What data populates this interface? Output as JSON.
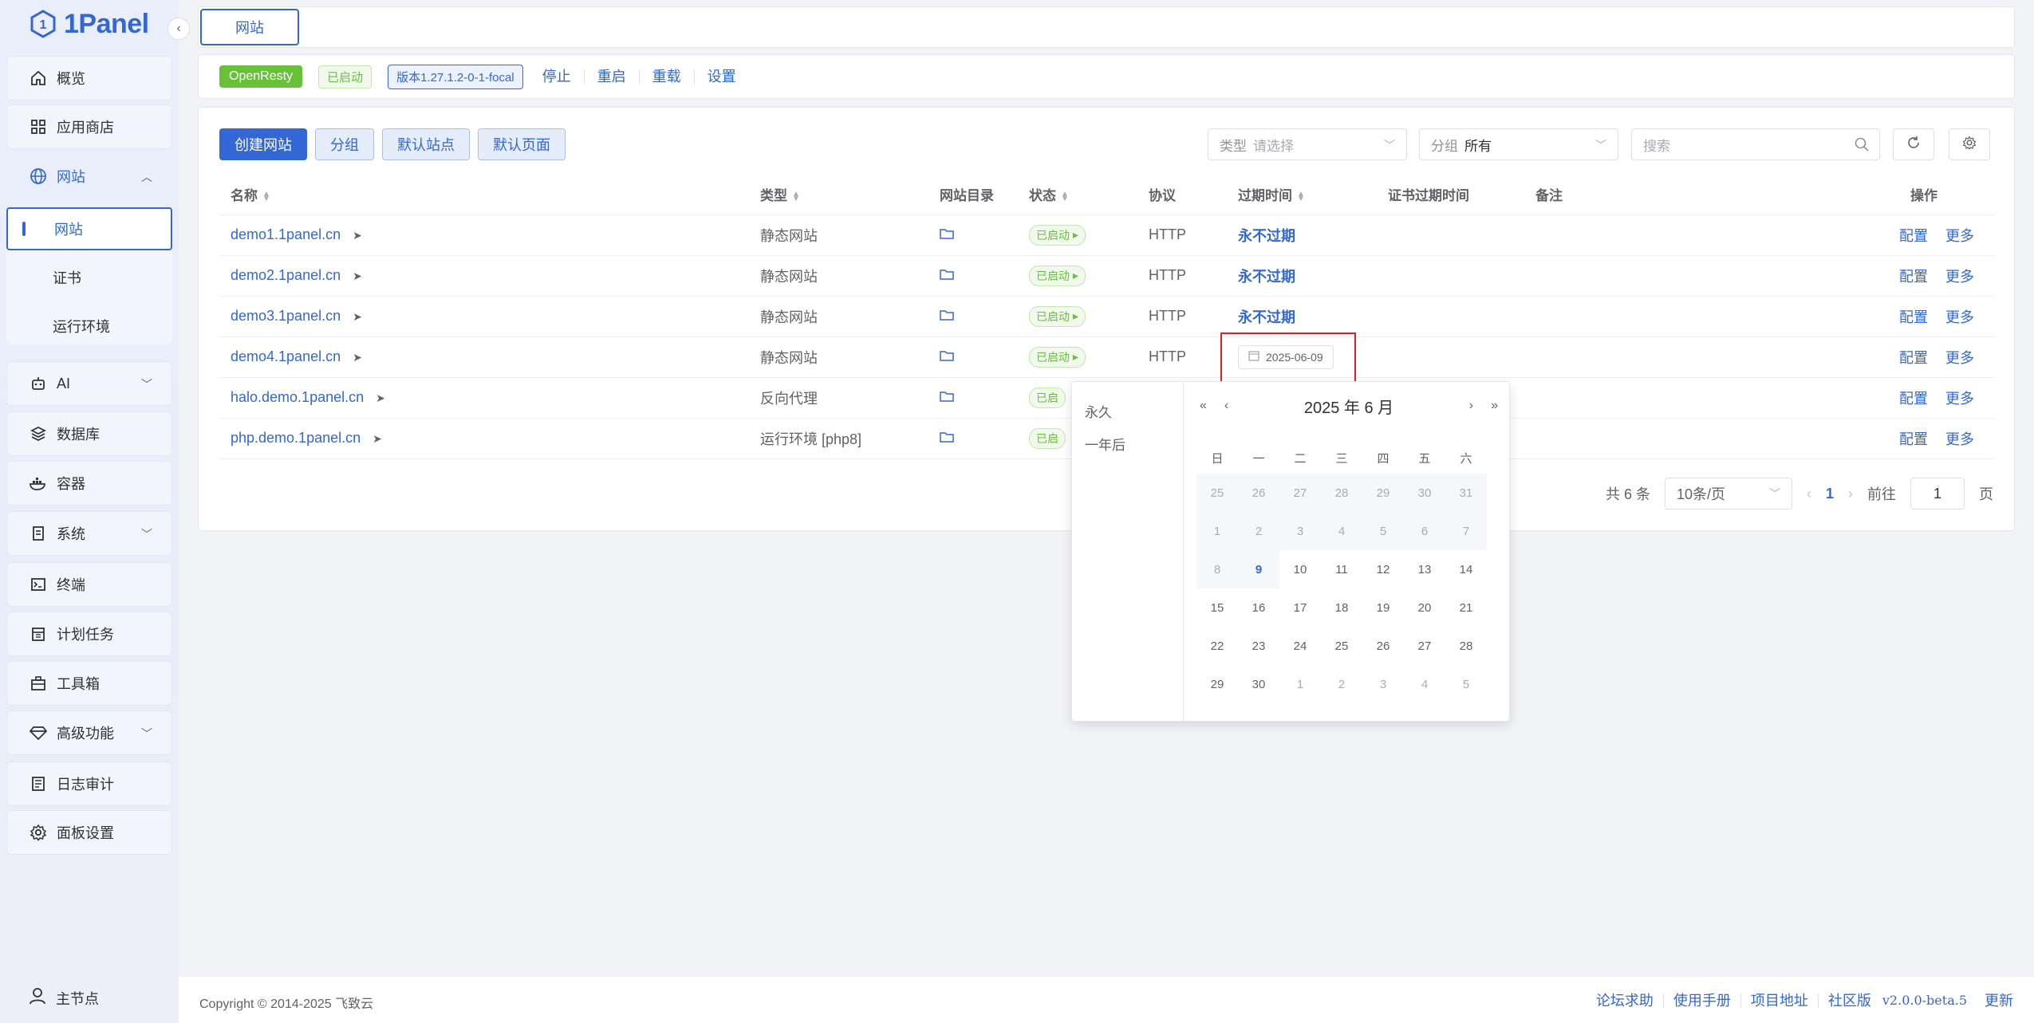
{
  "brand": {
    "name": "1Panel",
    "accent": "#3367d6"
  },
  "sidebar": {
    "items": [
      {
        "label": "概览",
        "icon": "home-icon"
      },
      {
        "label": "应用商店",
        "icon": "grid-icon"
      },
      {
        "label": "网站",
        "icon": "globe-icon"
      },
      {
        "label": "AI",
        "icon": "robot-icon"
      },
      {
        "label": "数据库",
        "icon": "database-icon"
      },
      {
        "label": "容器",
        "icon": "docker-icon"
      },
      {
        "label": "系统",
        "icon": "system-icon"
      },
      {
        "label": "终端",
        "icon": "terminal-icon"
      },
      {
        "label": "计划任务",
        "icon": "calendar-icon"
      },
      {
        "label": "工具箱",
        "icon": "toolbox-icon"
      },
      {
        "label": "高级功能",
        "icon": "diamond-icon"
      },
      {
        "label": "日志审计",
        "icon": "log-icon"
      },
      {
        "label": "面板设置",
        "icon": "gear-icon"
      }
    ],
    "sub_items": [
      "网站",
      "证书",
      "运行环境"
    ],
    "user_node": "主节点"
  },
  "tabs": [
    {
      "label": "网站"
    }
  ],
  "app": {
    "name": "OpenResty",
    "status": "已启动",
    "version": "版本1.27.1.2-0-1-focal",
    "actions": [
      "停止",
      "重启",
      "重载",
      "设置"
    ]
  },
  "toolbar": {
    "create": "创建网站",
    "group": "分组",
    "default_site": "默认站点",
    "default_page": "默认页面",
    "type_label": "类型",
    "type_placeholder": "请选择",
    "group_label": "分组",
    "group_value": "所有",
    "search_placeholder": "搜索"
  },
  "table": {
    "headers": [
      "名称",
      "类型",
      "网站目录",
      "状态",
      "协议",
      "过期时间",
      "证书过期时间",
      "备注",
      "操作"
    ],
    "rows": [
      {
        "name": "demo1.1panel.cn",
        "type": "静态网站",
        "status": "已启动",
        "protocol": "HTTP",
        "expire": "永不过期"
      },
      {
        "name": "demo2.1panel.cn",
        "type": "静态网站",
        "status": "已启动",
        "protocol": "HTTP",
        "expire": "永不过期"
      },
      {
        "name": "demo3.1panel.cn",
        "type": "静态网站",
        "status": "已启动",
        "protocol": "HTTP",
        "expire": "永不过期"
      },
      {
        "name": "demo4.1panel.cn",
        "type": "静态网站",
        "status": "已启动",
        "protocol": "HTTP",
        "expire": "2025-06-09"
      },
      {
        "name": "halo.demo.1panel.cn",
        "type": "反向代理",
        "status": "已启",
        "protocol": "",
        "expire": ""
      },
      {
        "name": "php.demo.1panel.cn",
        "type": "运行环境 [php8]",
        "status": "已启",
        "protocol": "",
        "expire": ""
      }
    ],
    "op_config": "配置",
    "op_more": "更多"
  },
  "pagination": {
    "total": "共 6 条",
    "page_size": "10条/页",
    "current": "1",
    "goto_label": "前往",
    "goto_value": "1",
    "goto_unit": "页"
  },
  "datepicker": {
    "shortcuts": [
      "永久",
      "一年后"
    ],
    "title": "2025 年  6 月",
    "weekdays": [
      "日",
      "一",
      "二",
      "三",
      "四",
      "五",
      "六"
    ],
    "weeks": [
      [
        "25",
        "26",
        "27",
        "28",
        "29",
        "30",
        "31"
      ],
      [
        "1",
        "2",
        "3",
        "4",
        "5",
        "6",
        "7"
      ],
      [
        "8",
        "9",
        "10",
        "11",
        "12",
        "13",
        "14"
      ],
      [
        "15",
        "16",
        "17",
        "18",
        "19",
        "20",
        "21"
      ],
      [
        "22",
        "23",
        "24",
        "25",
        "26",
        "27",
        "28"
      ],
      [
        "29",
        "30",
        "1",
        "2",
        "3",
        "4",
        "5"
      ]
    ]
  },
  "footer": {
    "copyright": "Copyright © 2014-2025 飞致云",
    "links": [
      "论坛求助",
      "使用手册",
      "项目地址",
      "社区版"
    ],
    "version": "v2.0.0-beta.5",
    "update": "更新"
  }
}
